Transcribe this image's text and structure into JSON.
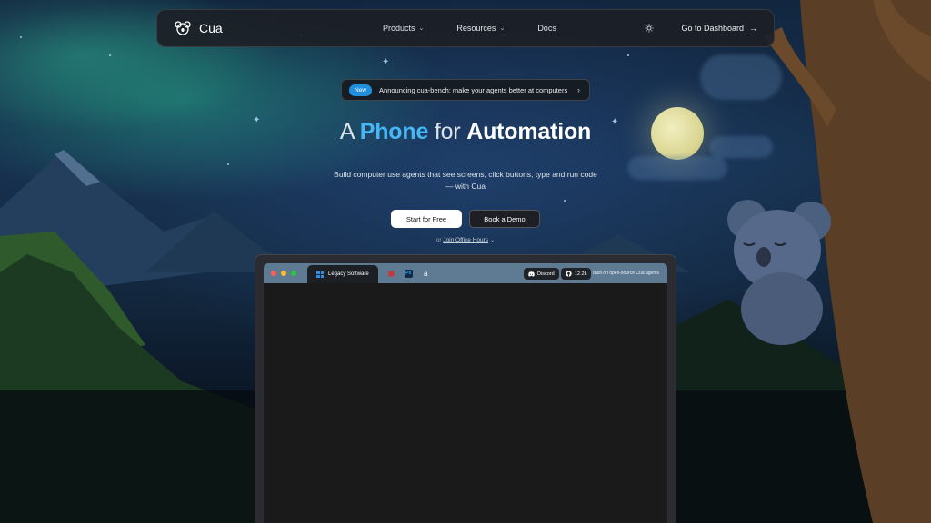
{
  "brand": {
    "name": "Cua"
  },
  "nav": {
    "items": [
      {
        "label": "Products",
        "has_dropdown": true
      },
      {
        "label": "Resources",
        "has_dropdown": true
      },
      {
        "label": "Docs",
        "has_dropdown": false
      }
    ],
    "theme_toggle_icon": "sun-icon",
    "dashboard_label": "Go to Dashboard",
    "dashboard_icon": "arrow-right-icon"
  },
  "announcement": {
    "badge": "New",
    "text": "Announcing cua-bench: make your agents better at computers",
    "icon": "chevron-right-icon"
  },
  "hero": {
    "title_a": "A",
    "title_phone": "Phone",
    "title_for": "for",
    "title_automation": "Automation",
    "subtitle": "Build computer use agents that see screens, click buttons, type and run code — with Cua",
    "primary_cta": "Start for Free",
    "secondary_cta": "Book a Demo",
    "office_prefix": "or",
    "office_link": "Join Office Hours"
  },
  "browser": {
    "active_tab": "Legacy Software",
    "tab_icons": [
      "windows-icon",
      "photoshop-icon",
      "amazon-icon"
    ],
    "ps_label": "Ps",
    "amazon_label": "a",
    "discord_label": "Discord",
    "github_count": "12.2k",
    "built_text": "Built on open-source Cua agents"
  },
  "colors": {
    "accent": "#48b6f5",
    "badge": "#1f8fe0",
    "traffic_red": "#ff5f57",
    "traffic_yellow": "#febc2e",
    "traffic_green": "#28c840"
  }
}
